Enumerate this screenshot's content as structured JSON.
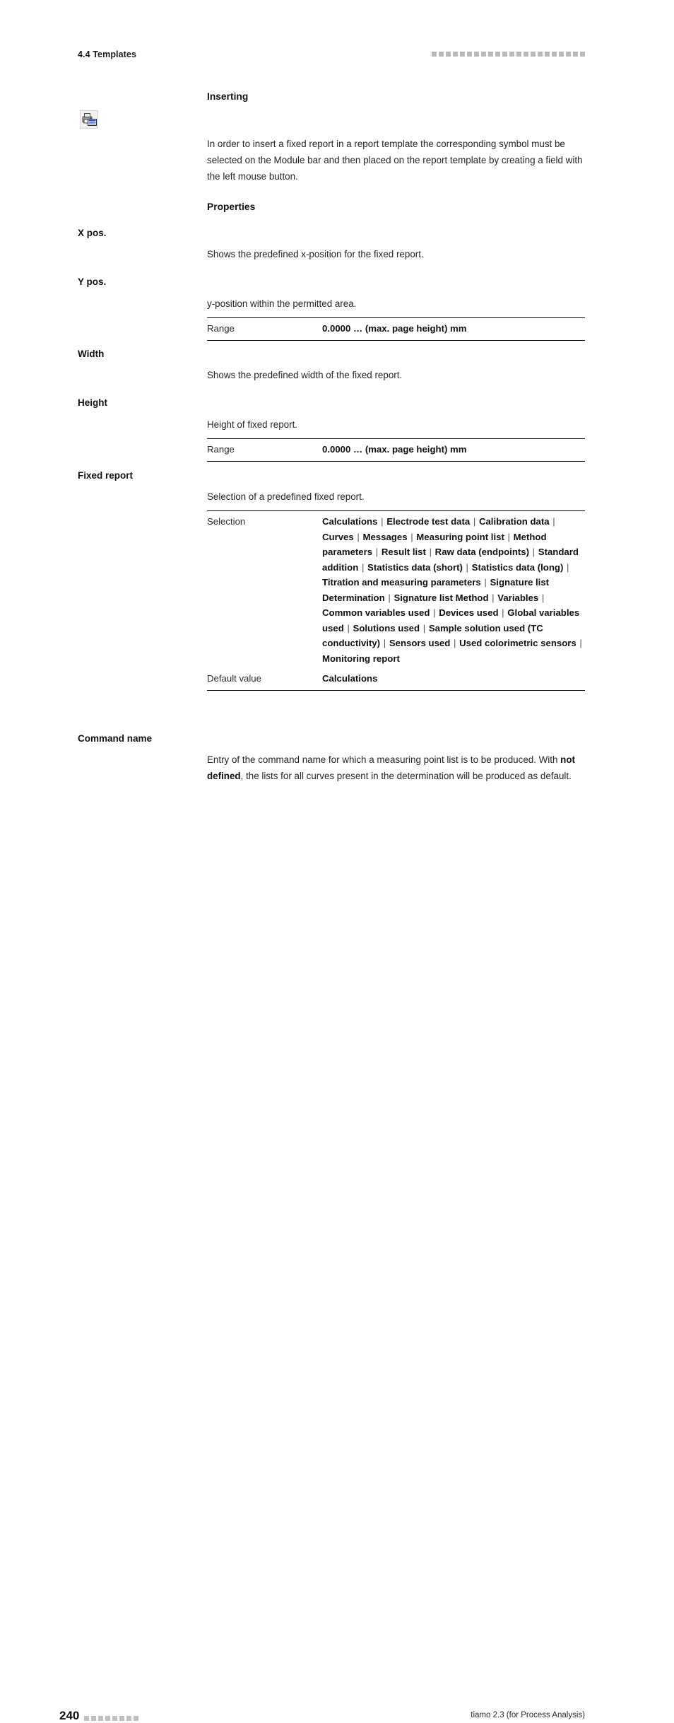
{
  "header": {
    "section": "4.4 Templates",
    "rule_squares": 22
  },
  "icon": {
    "name": "fixed-report-icon"
  },
  "sections": {
    "inserting": {
      "heading": "Inserting",
      "paragraph": "In order to insert a fixed report in a report template the corresponding symbol must be selected on the Module bar and then placed on the report template by creating a field with the left mouse button."
    },
    "properties": {
      "heading": "Properties"
    }
  },
  "properties": [
    {
      "label": "X pos.",
      "description": "Shows the predefined x-position for the fixed report."
    },
    {
      "label": "Y pos.",
      "description": "y-position within the permitted area.",
      "table": {
        "range_key": "Range",
        "range_value": "0.0000 … (max. page height) mm"
      }
    },
    {
      "label": "Width",
      "description": "Shows the predefined width of the fixed report."
    },
    {
      "label": "Height",
      "description": "Height of fixed report.",
      "table": {
        "range_key": "Range",
        "range_value": "0.0000 … (max. page height) mm"
      }
    },
    {
      "label": "Fixed report",
      "description": "Selection of a predefined fixed report.",
      "table": {
        "selection_key": "Selection",
        "selection_options": [
          "Calculations",
          "Electrode test data",
          "Calibration data",
          "Curves",
          "Messages",
          "Measuring point list",
          "Method parameters",
          "Result list",
          "Raw data (endpoints)",
          "Standard addition",
          "Statistics data (short)",
          "Statistics data (long)",
          "Titration and measuring parameters",
          "Signature list Determination",
          "Signature list Method",
          "Variables",
          "Common variables used",
          "Devices used",
          "Global variables used",
          "Solutions used",
          "Sample solution used (TC conductivity)",
          "Sensors used",
          "Used colorimetric sensors",
          "Monitoring report"
        ],
        "separator": "|",
        "default_key": "Default value",
        "default_value": "Calculations"
      }
    },
    {
      "label": "Command name",
      "description_parts": {
        "pre": "Entry of the command name for which a measuring point list is to be produced. With ",
        "emphasis": "not defined",
        "post": ", the lists for all curves present in the determination will be produced as default."
      }
    }
  ],
  "footer": {
    "page_number": "240",
    "rule_squares": 8,
    "product": "tiamo 2.3 (for Process Analysis)"
  },
  "colors": {
    "text": "#1b1b1b",
    "rule": "#b9b9b9",
    "table_rule": "#000000"
  }
}
